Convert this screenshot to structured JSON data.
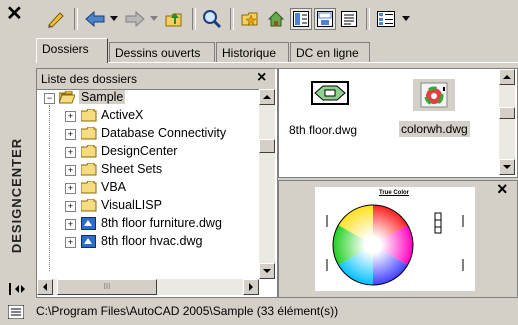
{
  "window": {
    "title": "DESIGNCENTER",
    "close_glyph": "✕",
    "autohide_glyph": "|◂▸",
    "accent": "#0a246a"
  },
  "tabs": [
    {
      "label": "Dossiers",
      "active": true
    },
    {
      "label": "Dessins ouverts",
      "active": false
    },
    {
      "label": "Historique",
      "active": false
    },
    {
      "label": "DC en ligne",
      "active": false
    }
  ],
  "tree": {
    "header": "Liste des dossiers",
    "close_glyph": "×",
    "items": [
      {
        "label": "Sample",
        "level": 0,
        "expander": "−",
        "icon": "folder-open-icon"
      },
      {
        "label": "ActiveX",
        "level": 1,
        "expander": "+",
        "icon": "folder-icon"
      },
      {
        "label": "Database Connectivity",
        "level": 1,
        "expander": "+",
        "icon": "folder-icon"
      },
      {
        "label": "DesignCenter",
        "level": 1,
        "expander": "+",
        "icon": "folder-icon"
      },
      {
        "label": "Sheet Sets",
        "level": 1,
        "expander": "+",
        "icon": "folder-icon"
      },
      {
        "label": "VBA",
        "level": 1,
        "expander": "+",
        "icon": "folder-icon"
      },
      {
        "label": "VisualLISP",
        "level": 1,
        "expander": "+",
        "icon": "folder-icon"
      },
      {
        "label": "8th floor furniture.dwg",
        "level": 1,
        "expander": "+",
        "icon": "dwg-icon"
      },
      {
        "label": "8th floor hvac.dwg",
        "level": 1,
        "expander": "+",
        "icon": "dwg-icon"
      }
    ],
    "scroll_thumb_glyph": "III"
  },
  "files": [
    {
      "name": "8th floor.dwg",
      "selected": false
    },
    {
      "name": "colorwh.dwg",
      "selected": true
    }
  ],
  "preview": {
    "title": "True Color",
    "close_glyph": "×"
  },
  "status": {
    "path": "C:\\Program Files\\AutoCAD 2005\\Sample (33 élément(s))"
  }
}
